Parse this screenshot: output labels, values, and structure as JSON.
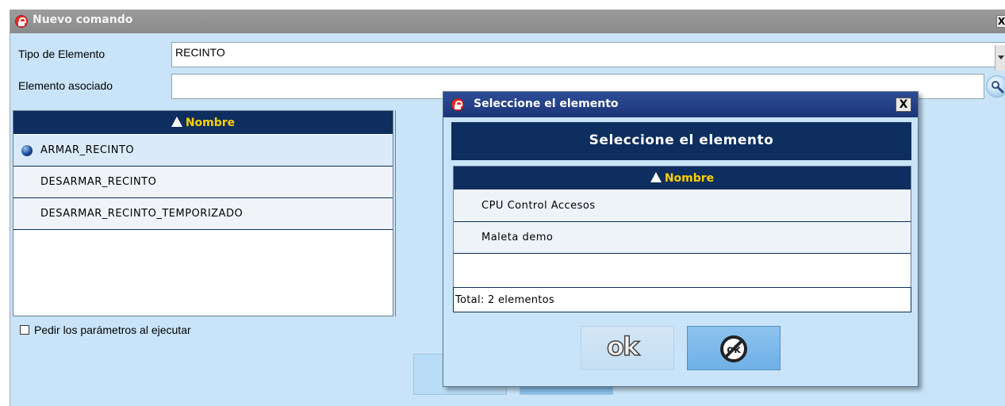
{
  "main_window": {
    "title": "Nuevo comando",
    "close_label": "X",
    "tipo_label": "Tipo de Elemento",
    "tipo_value": "RECINTO",
    "elemento_label": "Elemento asociado",
    "elemento_value": "",
    "list": {
      "header": "Nombre",
      "items": [
        {
          "label": "ARMAR_RECINTO",
          "selected": true
        },
        {
          "label": "DESARMAR_RECINTO",
          "selected": false
        },
        {
          "label": "DESARMAR_RECINTO_TEMPORIZADO",
          "selected": false
        }
      ]
    },
    "pedir_parametros_label": "Pedir los parámetros al ejecutar",
    "pedir_parametros_checked": false
  },
  "dialog": {
    "title": "Seleccione el elemento",
    "close_label": "X",
    "header": "Seleccione el elemento",
    "list": {
      "header": "Nombre",
      "items": [
        {
          "label": "CPU Control Accesos"
        },
        {
          "label": "Maleta demo"
        }
      ]
    },
    "total": "Total: 2 elementos",
    "ok_label": "ok"
  },
  "colors": {
    "navy": "#0d2e5e",
    "header_accent": "#ffd000",
    "panel_bg": "#c9e4f8",
    "dialog_title": "#1c3478"
  }
}
